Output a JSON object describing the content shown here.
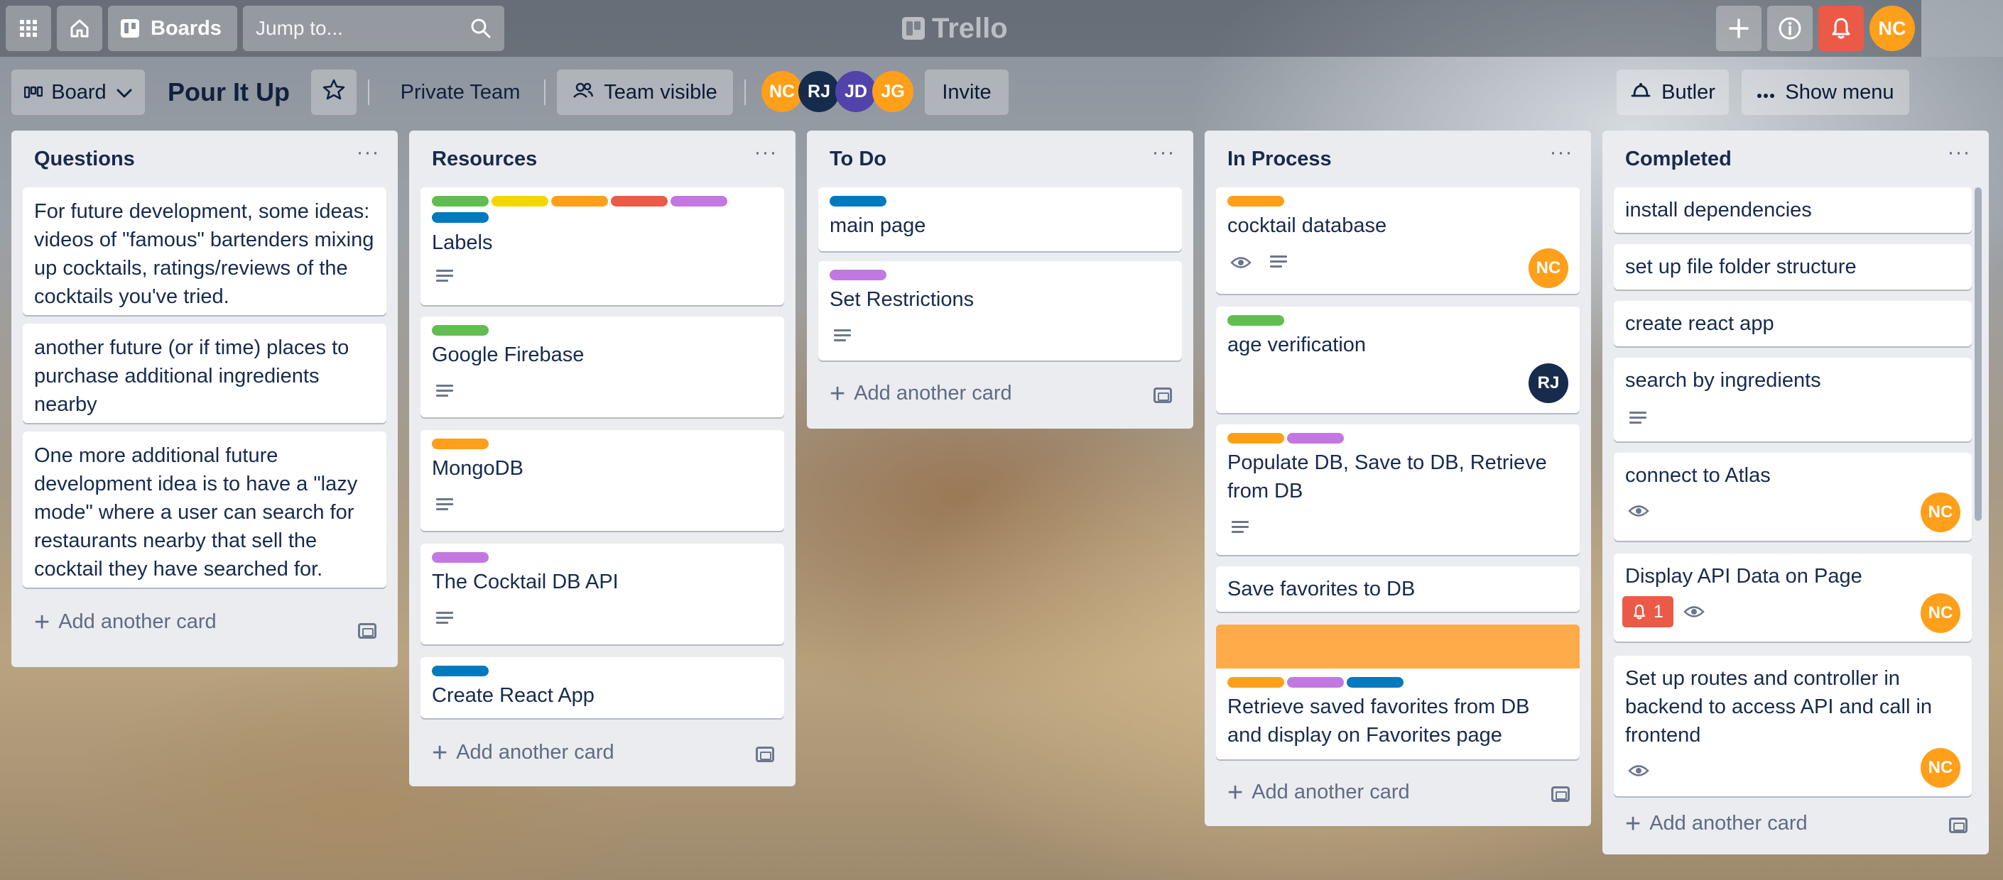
{
  "topbar": {
    "boards_label": "Boards",
    "search_placeholder": "Jump to...",
    "logo_text": "Trello",
    "user_initials": "NC"
  },
  "board": {
    "view_label": "Board",
    "title": "Pour It Up",
    "team_label": "Private Team",
    "visibility_label": "Team visible",
    "members": [
      "NC",
      "RJ",
      "JD",
      "JG"
    ],
    "invite_label": "Invite",
    "butler_label": "Butler",
    "show_menu_label": "Show menu"
  },
  "colors": {
    "green": "#61bd4f",
    "yellow": "#f2d600",
    "orange": "#ff9f1a",
    "red": "#eb5a46",
    "purple": "#c377e0",
    "blue": "#0079bf",
    "avatar_nc": "#ff9f1a",
    "avatar_rj": "#172b4d",
    "avatar_jd": "#5243aa",
    "avatar_jg": "#ff9f1a"
  },
  "add_card_label": "Add another card",
  "lists": [
    {
      "title": "Questions",
      "cards": [
        {
          "text": "For future development, some ideas: videos of \"famous\" bartenders mixing up cocktails, ratings/reviews of the cocktails you've tried."
        },
        {
          "text": "another future (or if time) places to purchase additional ingredients nearby"
        },
        {
          "text": "One more additional future development idea is to have a \"lazy mode\" where a user can search for restaurants nearby that sell the cocktail they have searched for."
        }
      ]
    },
    {
      "title": "Resources",
      "cards": [
        {
          "text": "Labels",
          "labels": [
            "green",
            "yellow",
            "orange",
            "red",
            "purple",
            "blue"
          ],
          "description": true
        },
        {
          "text": "Google Firebase",
          "labels": [
            "green"
          ],
          "description": true
        },
        {
          "text": "MongoDB",
          "labels": [
            "orange"
          ],
          "description": true
        },
        {
          "text": "The Cocktail DB API",
          "labels": [
            "purple"
          ],
          "description": true
        },
        {
          "text": "Create React App",
          "labels": [
            "blue"
          ]
        }
      ]
    },
    {
      "title": "To Do",
      "cards": [
        {
          "text": "main page",
          "labels": [
            "blue"
          ]
        },
        {
          "text": "Set Restrictions",
          "labels": [
            "purple"
          ],
          "description": true
        }
      ]
    },
    {
      "title": "In Process",
      "cards": [
        {
          "text": "cocktail database",
          "labels": [
            "orange"
          ],
          "watching": true,
          "description": true,
          "member": "NC"
        },
        {
          "text": "age verification",
          "labels": [
            "green"
          ],
          "member": "RJ"
        },
        {
          "text": "Populate DB, Save to DB, Retrieve from DB",
          "labels": [
            "orange",
            "purple"
          ],
          "description": true
        },
        {
          "text": "Save favorites to DB"
        },
        {
          "text": "Retrieve saved favorites from DB and display on Favorites page",
          "cover": "orange",
          "labels": [
            "orange",
            "purple",
            "blue"
          ]
        }
      ]
    },
    {
      "title": "Completed",
      "cards": [
        {
          "text": "install dependencies"
        },
        {
          "text": "set up file folder structure"
        },
        {
          "text": "create react app"
        },
        {
          "text": "search by ingredients",
          "description": true
        },
        {
          "text": "connect to Atlas",
          "watching": true,
          "member": "NC"
        },
        {
          "text": "Display API Data on Page",
          "notifications": "1",
          "watching": true,
          "member": "NC"
        },
        {
          "text": "Set up routes and controller in backend to access API and call in frontend",
          "watching": true,
          "member": "NC"
        }
      ]
    }
  ]
}
